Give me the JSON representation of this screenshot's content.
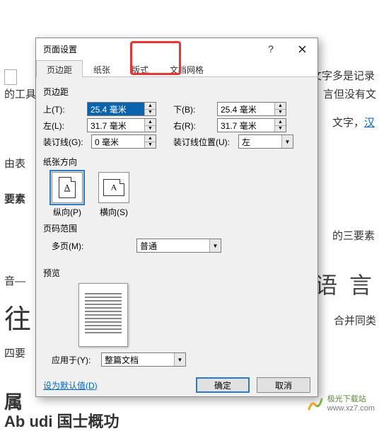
{
  "dialog": {
    "title": "页面设置",
    "help": "?",
    "tabs": [
      "页边距",
      "纸张",
      "版式",
      "文档网格"
    ],
    "active_tab": 0
  },
  "margins": {
    "section": "页边距",
    "top_label": "上(T):",
    "top_value": "25.4 毫米",
    "bottom_label": "下(B):",
    "bottom_value": "25.4 毫米",
    "left_label": "左(L):",
    "left_value": "31.7 毫米",
    "right_label": "右(R):",
    "right_value": "31.7 毫米",
    "gutter_label": "装订线(G):",
    "gutter_value": "0 毫米",
    "gutter_pos_label": "装订线位置(U):",
    "gutter_pos_value": "左"
  },
  "orientation": {
    "section": "纸张方向",
    "portrait": "纵向(P)",
    "landscape": "横向(S)"
  },
  "pages": {
    "section": "页码范围",
    "multi_label": "多页(M):",
    "multi_value": "普通"
  },
  "preview": {
    "section": "预览"
  },
  "apply": {
    "label": "应用于(Y):",
    "value": "整篇文档"
  },
  "buttons": {
    "default": "设为默认值(D)",
    "ok": "确定",
    "cancel": "取消"
  },
  "bg": {
    "t1": "文字多是记录",
    "t2": "的工具",
    "t3": "言但没有文",
    "t4": "文字，",
    "t4b": "汉",
    "t5": "由表",
    "t6": "要素",
    "t7": "的三要素",
    "t8": "音—",
    "t9": "语 言",
    "t10": "往",
    "t11": "合并同类",
    "t12": "四要",
    "t13": "属",
    "t14": "Ab  udi 国士概功"
  },
  "watermark": {
    "cn": "极光下载站",
    "url": "www.xz7.com"
  }
}
